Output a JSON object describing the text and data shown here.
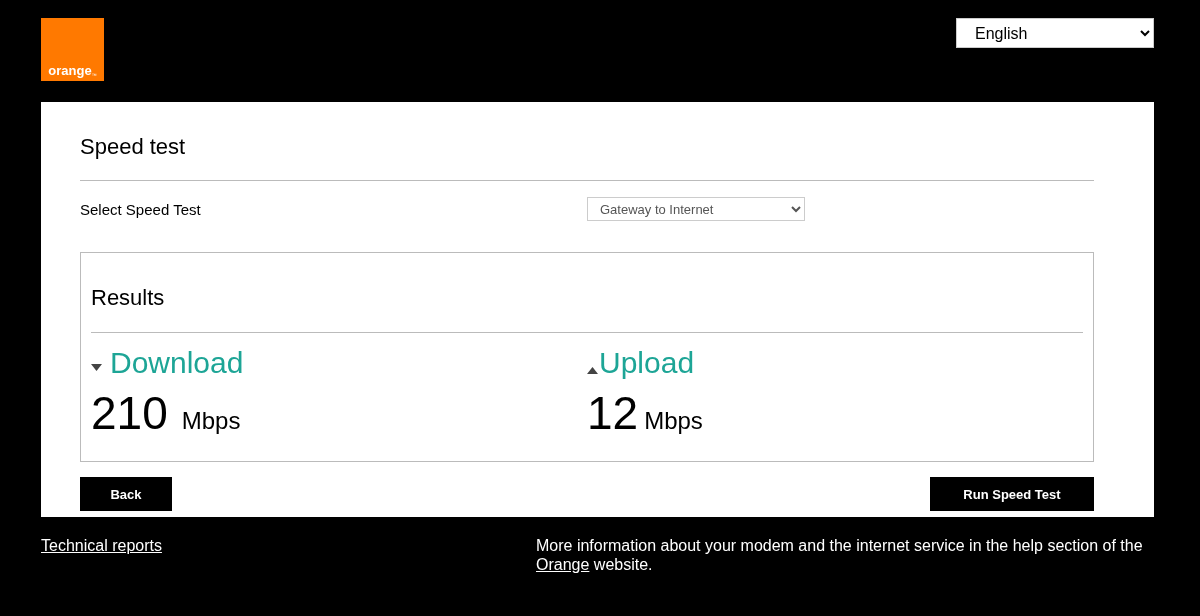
{
  "header": {
    "logo": {
      "text": "orange",
      "mark": "™"
    },
    "language": {
      "value": "English"
    }
  },
  "card": {
    "title": "Speed test",
    "select_label": "Select Speed Test",
    "select_value": "Gateway to Internet",
    "results": {
      "title": "Results",
      "items": [
        {
          "kind": "download",
          "label": "Download",
          "value": "210",
          "unit": "Mbps"
        },
        {
          "kind": "upload",
          "label": "Upload",
          "value": "12",
          "unit": "Mbps"
        }
      ]
    },
    "buttons": [
      {
        "kind": "back",
        "label": "Back"
      },
      {
        "kind": "run",
        "label": "Run Speed Test"
      }
    ]
  },
  "footer": {
    "link": "Technical reports",
    "help": {
      "before": "More information about your modem and the internet service in the help section of the ",
      "link": "Orange",
      "after": " website."
    }
  }
}
